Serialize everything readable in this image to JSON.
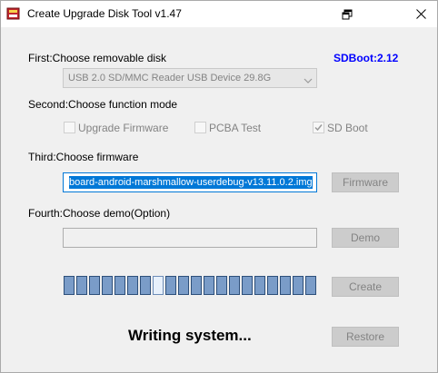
{
  "window": {
    "title": "Create Upgrade Disk Tool v1.47",
    "controls": {
      "restore_icon": "restore-icon",
      "close_icon": "close-icon"
    }
  },
  "step1": {
    "label": "First:Choose removable disk",
    "disk_selected": "USB 2.0 SD/MMC Reader USB Device   29.8G"
  },
  "sdboot_version": "SDBoot:2.12",
  "step2": {
    "label": "Second:Choose function mode",
    "options": [
      {
        "label": "Upgrade Firmware",
        "checked": false
      },
      {
        "label": "PCBA Test",
        "checked": false
      },
      {
        "label": "SD Boot",
        "checked": true
      }
    ]
  },
  "step3": {
    "label": "Third:Choose firmware",
    "firmware_file": "board-android-marshmallow-userdebug-v13.11.0.2.img",
    "button": "Firmware"
  },
  "step4": {
    "label": "Fourth:Choose demo(Option)",
    "demo_file": "",
    "button": "Demo"
  },
  "progress": {
    "segments": 20,
    "lit_segment": 7
  },
  "create_button": "Create",
  "restore_button": "Restore",
  "status_text": "Writing system...",
  "colors": {
    "accent": "#0078d7",
    "sdboot": "#0000ff",
    "progress_fill": "#7a9cc8"
  }
}
